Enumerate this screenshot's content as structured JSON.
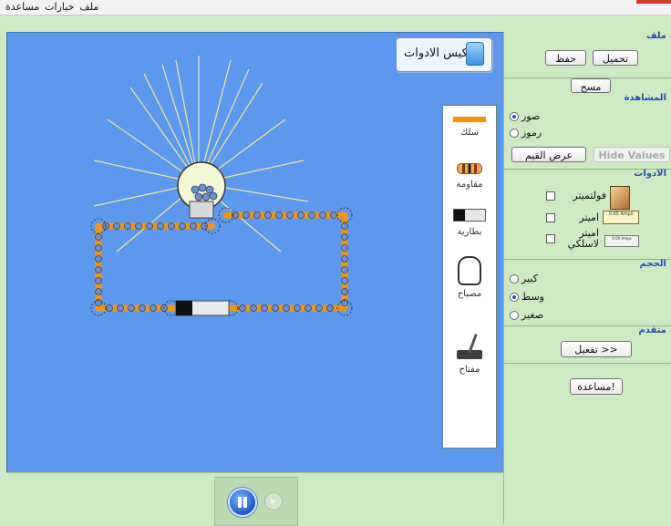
{
  "menu": {
    "items": [
      "ملف",
      "خيارات",
      "مساعدة"
    ]
  },
  "toolbox": {
    "label": "كيس الادوات"
  },
  "palette": {
    "wire": "سلك",
    "resistor": "مقاومة",
    "battery": "بطارية",
    "bulb": "مصباح",
    "switch": "مفتاح"
  },
  "panel": {
    "file": {
      "title": "ملف",
      "load": "تحميل",
      "save": "حفظ",
      "clear": "مسح"
    },
    "view": {
      "title": "المشاهدة",
      "pictures": "صور",
      "symbols": "رموز",
      "show_values": "عرض القيم",
      "hide_values": "Hide Values",
      "selected": "pictures"
    },
    "tools": {
      "title": "الادوات",
      "voltmeter": "فولتميتر",
      "ammeter": "اميتر",
      "noncontact_ammeter_line1": "اميتر",
      "noncontact_ammeter_line2": "لاسلكي",
      "ammeter_reading": "0.00 Amps",
      "noncontact_reading": "0.00 Amps"
    },
    "size": {
      "title": "الحجم",
      "large": "كبير",
      "medium": "وسط",
      "small": "صغير",
      "selected": "medium"
    },
    "advanced": {
      "title": "متقدم",
      "enable": "تفعيل >>"
    },
    "help": "مساعدة!"
  },
  "colors": {
    "canvas": "#5c98ed",
    "panel": "#cfe9c5",
    "wire": "#e8961f",
    "accent": "#2a4ea8"
  }
}
